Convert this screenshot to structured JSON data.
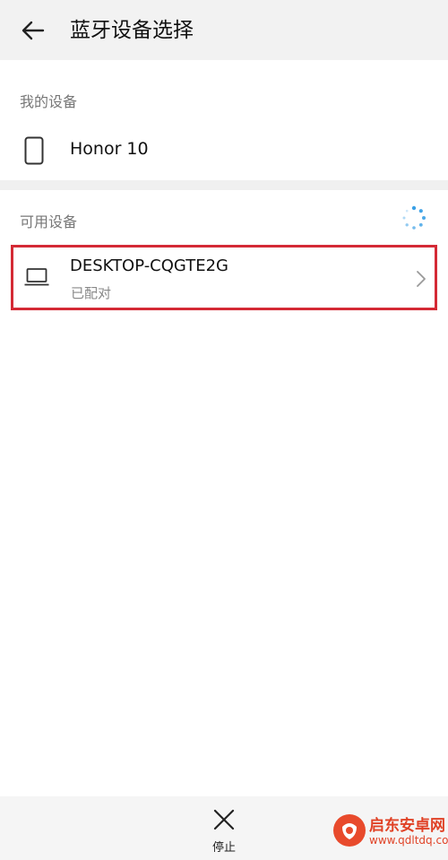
{
  "header": {
    "title": "蓝牙设备选择"
  },
  "my_devices": {
    "label": "我的设备",
    "items": [
      {
        "name": "Honor 10",
        "icon": "phone-icon"
      }
    ]
  },
  "available_devices": {
    "label": "可用设备",
    "items": [
      {
        "name": "DESKTOP-CQGTE2G",
        "status": "已配对",
        "icon": "laptop-icon"
      }
    ]
  },
  "bottom_bar": {
    "stop_label": "停止"
  },
  "watermark": {
    "title": "启东安卓网",
    "url": "www.qdltdq.com"
  },
  "colors": {
    "highlight_border": "#d42a35",
    "spinner": "#3aa0e6",
    "watermark": "#e04226"
  }
}
